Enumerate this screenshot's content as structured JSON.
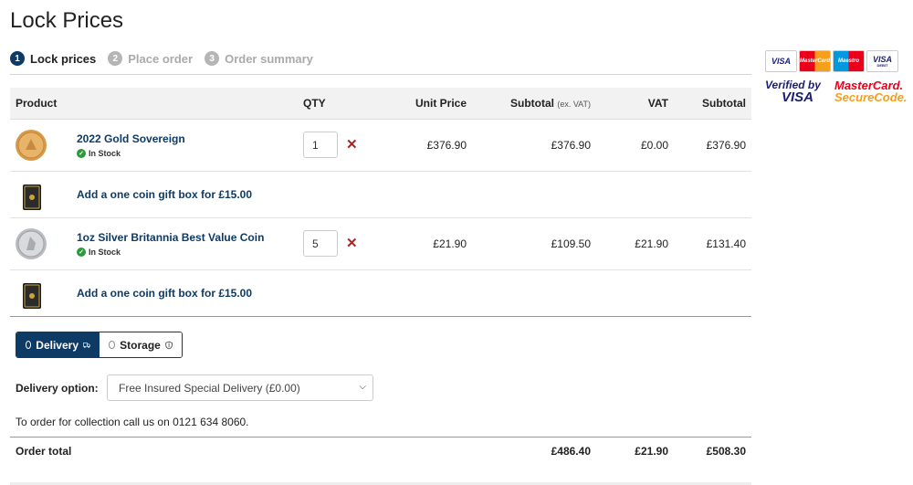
{
  "page": {
    "title": "Lock Prices"
  },
  "steps": [
    {
      "num": "1",
      "label": "Lock prices"
    },
    {
      "num": "2",
      "label": "Place order"
    },
    {
      "num": "3",
      "label": "Order summary"
    }
  ],
  "table": {
    "headers": {
      "product": "Product",
      "qty": "QTY",
      "unit_price": "Unit Price",
      "subtotal_ex": "Subtotal",
      "subtotal_ex_note": "(ex. VAT)",
      "vat": "VAT",
      "subtotal": "Subtotal"
    },
    "rows": [
      {
        "name": "2022 Gold Sovereign",
        "stock": "In Stock",
        "qty": "1",
        "unit_price": "£376.90",
        "subtotal_ex": "£376.90",
        "vat": "£0.00",
        "subtotal": "£376.90",
        "gift": "Add a one coin gift box for £15.00"
      },
      {
        "name": "1oz Silver Britannia Best Value Coin",
        "stock": "In Stock",
        "qty": "5",
        "unit_price": "£21.90",
        "subtotal_ex": "£109.50",
        "vat": "£21.90",
        "subtotal": "£131.40",
        "gift": "Add a one coin gift box for £15.00"
      }
    ],
    "remove_glyph": "✕"
  },
  "fulfilment": {
    "delivery_label": "Delivery",
    "storage_label": "Storage",
    "selected": "Delivery"
  },
  "delivery": {
    "label": "Delivery option:",
    "selected": "Free Insured Special Delivery (£0.00)",
    "collection_note": "To order for collection call us on 0121 634 8060."
  },
  "totals": {
    "label": "Order total",
    "subtotal_ex": "£486.40",
    "vat": "£21.90",
    "subtotal": "£508.30"
  },
  "payment_cards": {
    "visa": "VISA",
    "mastercard": "MasterCard",
    "maestro": "Maestro",
    "visa_debit": "VISA",
    "visa_debit_sub": "DEBIT",
    "verified_by": "Verified by",
    "verified_visa": "VISA",
    "securecode_mc": "MasterCard.",
    "securecode": "SecureCode."
  },
  "colors": {
    "brand": "#0e3a66",
    "remove": "#b22222",
    "stock": "#2a9a3a"
  }
}
